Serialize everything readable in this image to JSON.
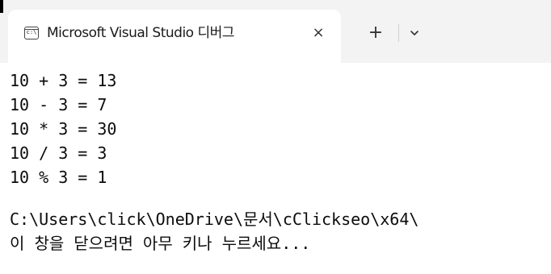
{
  "tab": {
    "title": "Microsoft Visual Studio 디버그",
    "icon": "console-icon",
    "icon_text": "c:\\",
    "close_glyph": "×"
  },
  "tabbar": {
    "new_tab_glyph": "+",
    "dropdown_icon": "chevron-down-icon"
  },
  "console": {
    "lines": [
      "10 + 3 = 13",
      "10 - 3 = 7",
      "10 * 3 = 30",
      "10 / 3 = 3",
      "10 % 3 = 1",
      "",
      "C:\\Users\\click\\OneDrive\\문서\\cClickseo\\x64\\",
      "이 창을 닫으려면 아무 키나 누르세요..."
    ]
  },
  "colors": {
    "titlebar_bg": "#f3f3f3",
    "tab_bg": "#ffffff",
    "console_bg": "#ffffff",
    "console_text": "#0c0c0c"
  }
}
